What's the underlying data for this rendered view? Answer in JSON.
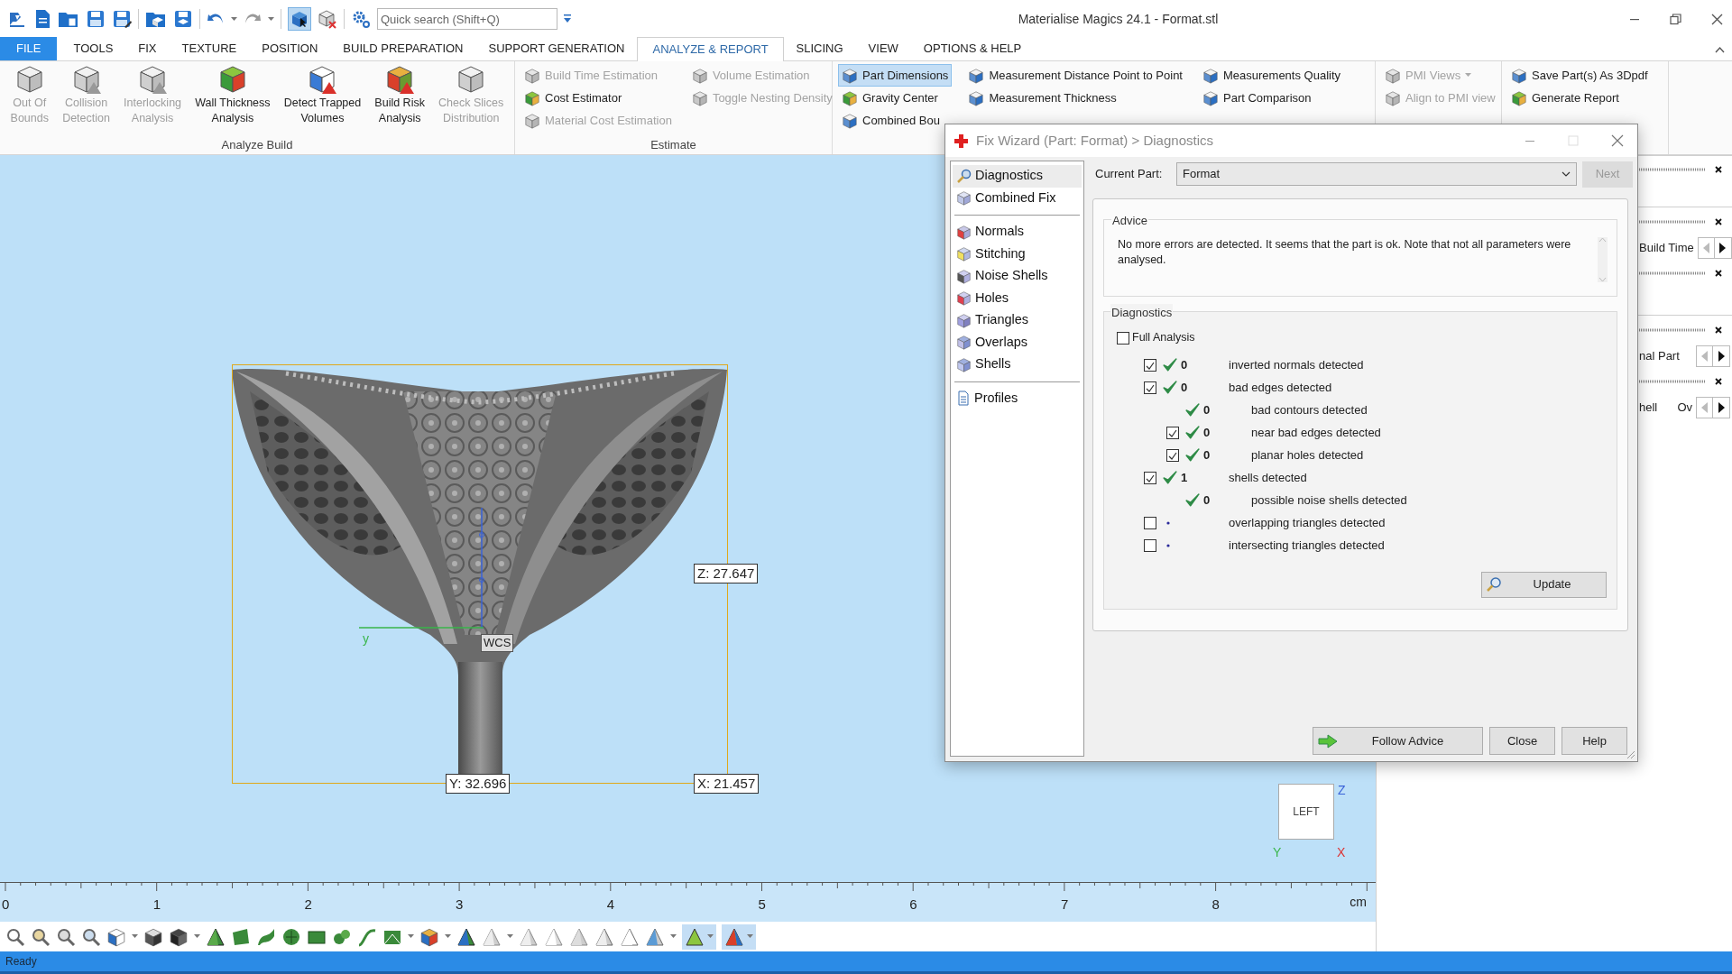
{
  "window": {
    "title": "Materialise Magics 24.1 - Format.stl"
  },
  "quick_search": {
    "placeholder": "Quick search (Shift+Q)"
  },
  "tabs": [
    {
      "label": "FILE",
      "kind": "file",
      "selected": false
    },
    {
      "label": "TOOLS",
      "kind": "tab",
      "selected": false
    },
    {
      "label": "FIX",
      "kind": "tab",
      "selected": false
    },
    {
      "label": "TEXTURE",
      "kind": "tab",
      "selected": false
    },
    {
      "label": "POSITION",
      "kind": "tab",
      "selected": false
    },
    {
      "label": "BUILD PREPARATION",
      "kind": "tab",
      "selected": false
    },
    {
      "label": "SUPPORT GENERATION",
      "kind": "tab",
      "selected": false
    },
    {
      "label": "ANALYZE & REPORT",
      "kind": "tab",
      "selected": true
    },
    {
      "label": "SLICING",
      "kind": "tab",
      "selected": false
    },
    {
      "label": "VIEW",
      "kind": "tab",
      "selected": false
    },
    {
      "label": "OPTIONS & HELP",
      "kind": "tab",
      "selected": false
    }
  ],
  "ribbon": {
    "groups": [
      {
        "kind": "large",
        "label": "Analyze Build",
        "buttons": [
          {
            "lines": [
              "Out Of",
              "Bounds"
            ],
            "disabled": true
          },
          {
            "lines": [
              "Collision",
              "Detection"
            ],
            "disabled": true
          },
          {
            "lines": [
              "Interlocking",
              "Analysis"
            ],
            "disabled": true
          },
          {
            "lines": [
              "Wall Thickness",
              "Analysis"
            ],
            "disabled": false
          },
          {
            "lines": [
              "Detect Trapped",
              "Volumes"
            ],
            "disabled": false
          },
          {
            "lines": [
              "Build Risk",
              "Analysis"
            ],
            "disabled": false
          },
          {
            "lines": [
              "Check Slices",
              "Distribution"
            ],
            "disabled": true
          }
        ]
      },
      {
        "kind": "small",
        "label": "Estimate",
        "columns": [
          [
            {
              "label": "Build Time Estimation",
              "disabled": true,
              "selected": false
            },
            {
              "label": "Cost Estimator",
              "disabled": false,
              "selected": false
            },
            {
              "label": "Material Cost Estimation",
              "disabled": true,
              "selected": false
            }
          ],
          [
            {
              "label": "Volume Estimation",
              "disabled": true,
              "selected": false
            },
            {
              "label": "Toggle Nesting Density",
              "disabled": true,
              "selected": false
            }
          ]
        ]
      },
      {
        "kind": "small",
        "columns": [
          [
            {
              "label": "Part Dimensions",
              "disabled": false,
              "selected": true
            },
            {
              "label": "Gravity Center",
              "disabled": false,
              "selected": false
            },
            {
              "label": "Combined Bou",
              "disabled": false,
              "selected": false
            }
          ],
          [
            {
              "label": "Measurement Distance Point to Point",
              "disabled": false,
              "selected": false
            },
            {
              "label": "Measurement Thickness",
              "disabled": false,
              "selected": false
            }
          ],
          [
            {
              "label": "Measurements Quality",
              "disabled": false,
              "selected": false
            },
            {
              "label": "Part Comparison",
              "disabled": false,
              "selected": false
            }
          ]
        ]
      },
      {
        "kind": "small",
        "columns": [
          [
            {
              "label": "PMI Views",
              "disabled": true,
              "selected": false,
              "dropdown": true
            },
            {
              "label": "Align to PMI view",
              "disabled": true,
              "selected": false
            }
          ]
        ]
      },
      {
        "kind": "small",
        "columns": [
          [
            {
              "label": "Save Part(s) As 3Dpdf",
              "disabled": false,
              "selected": false
            },
            {
              "label": "Generate Report",
              "disabled": false,
              "selected": false
            }
          ]
        ]
      }
    ]
  },
  "viewport": {
    "dimensions": {
      "z": "Z: 27.647",
      "y": "Y: 32.696",
      "x": "X: 21.457"
    },
    "origin_label": "WCS",
    "y_axis_label": "y",
    "view_cube": {
      "face": "LEFT",
      "z": "Z",
      "y": "Y",
      "x": "X"
    }
  },
  "ruler": {
    "labels": [
      "0",
      "1",
      "2",
      "3",
      "4",
      "5",
      "6",
      "7",
      "8"
    ],
    "unit": "cm"
  },
  "side_panels": [
    [
      {
        "closable": true
      }
    ],
    [
      {
        "closable": true,
        "texts": [
          "Build Time"
        ]
      },
      {
        "closable": true
      }
    ],
    [
      {
        "closable": true,
        "texts": [
          "nal Part"
        ]
      },
      {
        "closable": true,
        "texts": [
          "hell",
          "Ov"
        ]
      }
    ]
  ],
  "fix_wizard": {
    "title": "Fix Wizard (Part: Format) > Diagnostics",
    "nav_sections": [
      [
        {
          "label": "Diagnostics",
          "selected": true
        },
        {
          "label": "Combined Fix",
          "selected": false
        }
      ],
      [
        {
          "label": "Normals",
          "selected": false
        },
        {
          "label": "Stitching",
          "selected": false
        },
        {
          "label": "Noise Shells",
          "selected": false
        },
        {
          "label": "Holes",
          "selected": false
        },
        {
          "label": "Triangles",
          "selected": false
        },
        {
          "label": "Overlaps",
          "selected": false
        },
        {
          "label": "Shells",
          "selected": false
        }
      ],
      [
        {
          "label": "Profiles",
          "selected": false
        }
      ]
    ],
    "current_part": {
      "label": "Current Part:",
      "value": "Format"
    },
    "next_button": {
      "label": "Next",
      "disabled": true
    },
    "advice": {
      "title": "Advice",
      "text": "No more errors are detected. It seems that the part is ok. Note that not all parameters were analysed."
    },
    "diagnostics": {
      "title": "Diagnostics",
      "full_analysis": {
        "label": "Full Analysis",
        "checked": false
      },
      "rows": [
        {
          "kind": "checkable",
          "checked": true,
          "passed": true,
          "count": "0",
          "label": "inverted normals detected"
        },
        {
          "kind": "checkable",
          "checked": true,
          "passed": true,
          "count": "0",
          "label": "bad edges detected",
          "children": [
            {
              "kind": "plain",
              "passed": true,
              "count": "0",
              "label": "bad contours detected"
            },
            {
              "kind": "checkable",
              "checked": true,
              "passed": true,
              "count": "0",
              "label": "near bad edges detected"
            },
            {
              "kind": "checkable",
              "checked": true,
              "passed": true,
              "count": "0",
              "label": "planar holes detected"
            }
          ]
        },
        {
          "kind": "checkable",
          "checked": true,
          "passed": true,
          "count": "1",
          "label": "shells detected",
          "children": [
            {
              "kind": "plain",
              "passed": true,
              "count": "0",
              "label": "possible noise shells detected"
            }
          ]
        },
        {
          "kind": "checkable",
          "checked": false,
          "passed": false,
          "label": "overlapping triangles detected"
        },
        {
          "kind": "checkable",
          "checked": false,
          "passed": false,
          "label": "intersecting triangles detected"
        }
      ]
    },
    "update_button": "Update",
    "buttons": [
      "Follow Advice",
      "Close",
      "Help"
    ]
  },
  "status_bar": {
    "text": "Ready"
  }
}
